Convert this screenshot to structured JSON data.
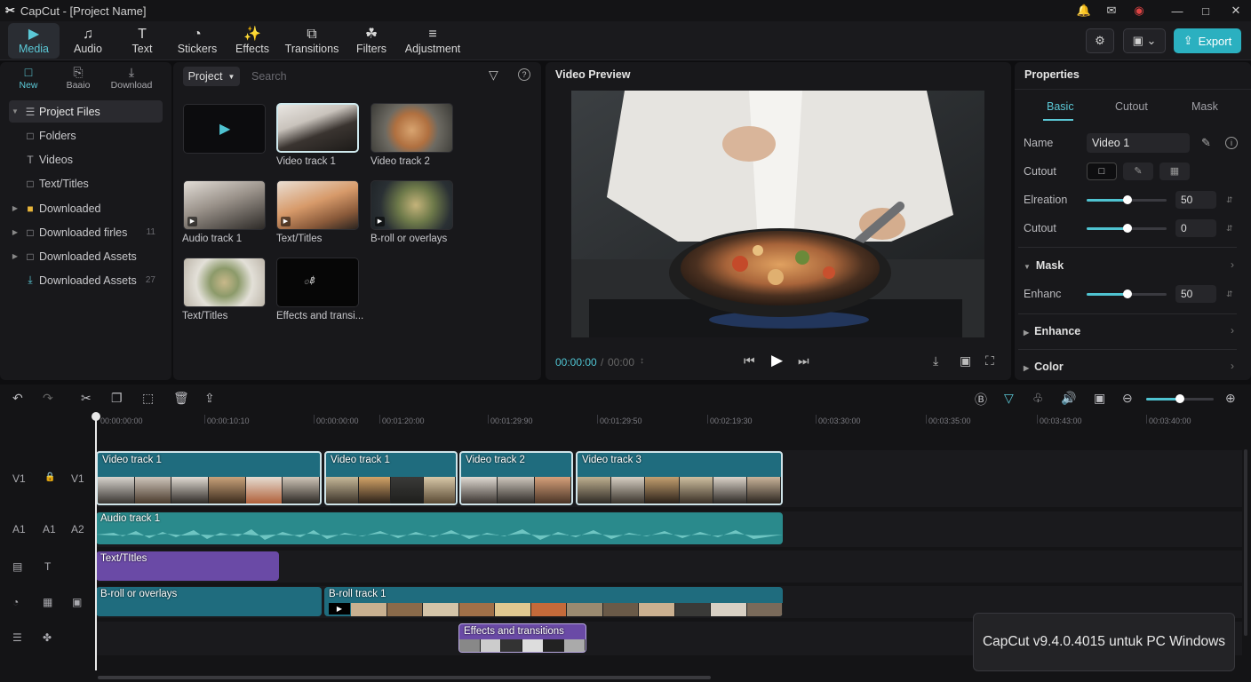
{
  "app": {
    "logo": "✂",
    "title": "CapCut - [Project Name]"
  },
  "window_controls": {
    "bell": "🔔",
    "feedback": "✉",
    "record": "◉",
    "minimize": "—",
    "maximize": "□",
    "close": "✕"
  },
  "toolbar": {
    "items": [
      {
        "label": "Media",
        "icon": "▶"
      },
      {
        "label": "Audio",
        "icon": "♫"
      },
      {
        "label": "Text",
        "icon": "T"
      },
      {
        "label": "Stickers",
        "icon": "◔"
      },
      {
        "label": "Effects",
        "icon": "✨"
      },
      {
        "label": "Transitions",
        "icon": "⧉"
      },
      {
        "label": "Filters",
        "icon": "☘"
      },
      {
        "label": "Adjustment",
        "icon": "≡"
      }
    ],
    "settings_icon": "⚙",
    "layout_icon": "▣ ⌄",
    "export_label": "Export",
    "export_icon": "⇪",
    "accent": "#2bb0c0"
  },
  "left_nav": {
    "buttons": [
      {
        "label": "New",
        "icon": "□"
      },
      {
        "label": "Baaio",
        "icon": "⎘"
      },
      {
        "label": "Download",
        "icon": "⤓"
      }
    ],
    "tree": [
      {
        "label": "Project Files",
        "arrow": "▼",
        "icon": "☰",
        "count": ""
      },
      {
        "label": "Folders",
        "arrow": "",
        "icon": "□",
        "count": ""
      },
      {
        "label": "Videos",
        "arrow": "",
        "icon": "T",
        "count": ""
      },
      {
        "label": "Text/Titles",
        "arrow": "",
        "icon": "□",
        "count": ""
      },
      {
        "label": "Downloaded",
        "arrow": "▶",
        "icon": "■",
        "count": ""
      },
      {
        "label": "Downloaded firles",
        "arrow": "▶",
        "icon": "□",
        "count": "11"
      },
      {
        "label": "Downloaded Assets",
        "arrow": "▶",
        "icon": "□",
        "count": ""
      },
      {
        "label": "Downloaded Assets",
        "arrow": "",
        "icon": "⤓",
        "count": "27"
      }
    ]
  },
  "media": {
    "project_label": "Project",
    "search_placeholder": "Search",
    "filter_icon": "▽",
    "help_icon": "?",
    "items": [
      {
        "label": ""
      },
      {
        "label": "Video track 1"
      },
      {
        "label": "Video track 2"
      },
      {
        "label": "Audio track 1"
      },
      {
        "label": "Text/Titles"
      },
      {
        "label": "B-roll or overlays"
      },
      {
        "label": "Text/Titles"
      },
      {
        "label": "Effects and transi..."
      }
    ],
    "thumb_glyph": "۞฿"
  },
  "preview": {
    "title": "Video Preview",
    "time_current": "00:00:00",
    "time_sep": "/",
    "time_total": "00:00",
    "spin": "↕",
    "prev_icon": "⏮",
    "play_icon": "▶",
    "next_icon": "⏭",
    "download_icon": "⤓",
    "ratio_icon": "▣",
    "fullscreen_icon": "⛶"
  },
  "properties": {
    "title": "Properties",
    "tabs": [
      "Basic",
      "Cutout",
      "Mask"
    ],
    "name_label": "Name",
    "name_value": "Video 1",
    "cutout_label": "Cutout",
    "rows": [
      {
        "label": "Elreation",
        "value": "50",
        "fraction": 0.5
      },
      {
        "label": "Cutout",
        "value": "0",
        "fraction": 0.5
      }
    ],
    "mask_section": "Mask",
    "enhance_row": {
      "label": "Enhanc",
      "value": "50",
      "fraction": 0.5
    },
    "enhance_section": "Enhance",
    "color_section": "Color"
  },
  "timeline": {
    "tools": [
      "↶",
      "↷",
      "✂",
      "❐",
      "⬚",
      "🗑",
      "⇪"
    ],
    "right_tools": [
      "Ⓑ",
      "▽",
      "♧",
      "🔊",
      "▣",
      "⊖",
      "⊕"
    ],
    "zoom_fraction": 0.5,
    "ticks": [
      "00:00:00:00",
      "00:00:10:10",
      "00:00:00:00",
      "00:01:20:00",
      "00:01:29:90",
      "00:01:29:50",
      "00:02:19:30",
      "00:03:30:00",
      "00:03:35:00",
      "00:03:43:00",
      "00:03:40:00"
    ],
    "track_heads": [
      {
        "a": "V1",
        "b": "🔒",
        "c": "V1"
      },
      {
        "a": "A1",
        "b": "A1",
        "c": "A2"
      },
      {
        "a": "▤",
        "b": "T",
        "c": ""
      },
      {
        "a": "◔",
        "b": "▦",
        "c": "▣"
      },
      {
        "a": "☰",
        "b": "✤",
        "c": ""
      }
    ],
    "video_clips": [
      "Video track 1",
      "Video track 1",
      "Video track 2",
      "Video track 3"
    ],
    "audio_clip": "Audio track 1",
    "text_clip": "Text/TItles",
    "broll_clips": [
      "B-roll or overlays",
      "B-roll track 1"
    ],
    "effects_clip": "Effects and transitions"
  },
  "toast": "CapCut v9.4.0.4015 untuk PC Windows"
}
